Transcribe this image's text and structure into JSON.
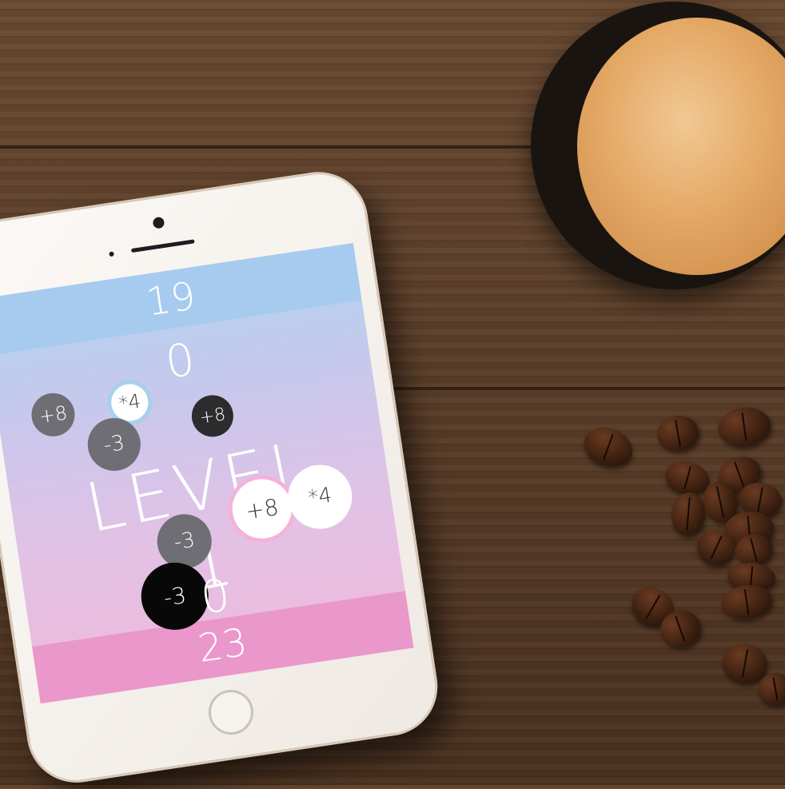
{
  "game": {
    "top_score": "19",
    "top_counter": "0",
    "level_label": "LEVEL 1",
    "bottom_counter": "0",
    "bottom_score": "23",
    "bubbles": [
      {
        "label": "+8",
        "style": "grey"
      },
      {
        "label": "*4",
        "style": "white-blue-ring"
      },
      {
        "label": "-3",
        "style": "grey"
      },
      {
        "label": "+8",
        "style": "dark"
      },
      {
        "label": "+8",
        "style": "white-pink-ring"
      },
      {
        "label": "*4",
        "style": "white"
      },
      {
        "label": "-3",
        "style": "grey"
      },
      {
        "label": "-3",
        "style": "black"
      }
    ]
  },
  "colors": {
    "top_band": "#a6cbee",
    "bottom_band": "#ea97cb",
    "gradient_top": "#b2d4ef",
    "gradient_bottom": "#f0b9dc",
    "ring_blue": "#a9cfee",
    "ring_pink": "#f5b2d8"
  }
}
